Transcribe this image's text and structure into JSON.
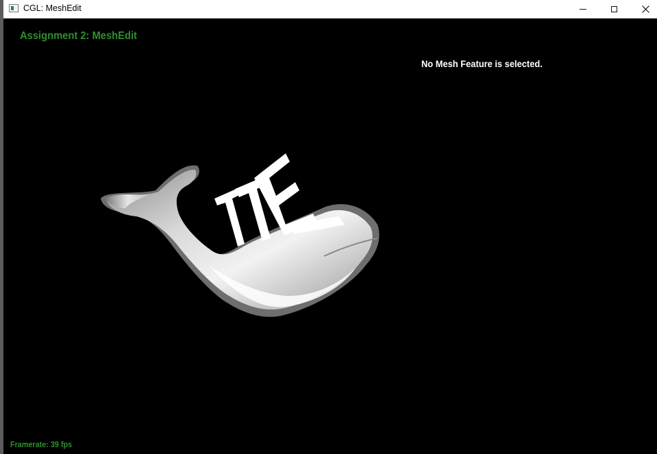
{
  "window": {
    "title": "CGL: MeshEdit",
    "icon": "app-window-icon",
    "controls": {
      "minimize": "minimize-icon",
      "maximize": "maximize-icon",
      "close": "close-icon"
    }
  },
  "viewport": {
    "assignment_title": "Assignment 2: MeshEdit",
    "selection_status": "No Mesh Feature is selected.",
    "framerate_label": "Framerate: 39 fps",
    "background_color": "#000000",
    "hud_accent_color": "#2f8f2f",
    "mesh_shading": "white-grey"
  }
}
